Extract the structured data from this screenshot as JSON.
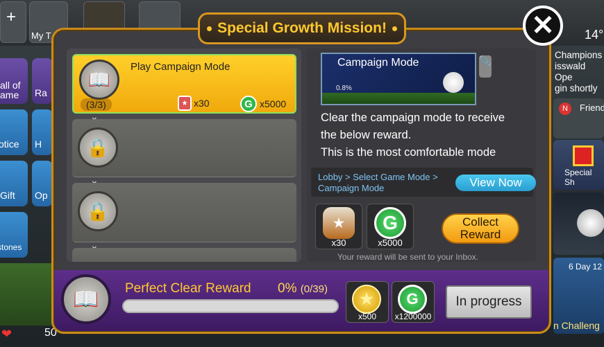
{
  "background": {
    "top_texts": [
      "My T",
      "14°"
    ],
    "left_menu": [
      "all of ame",
      "Ra",
      "otice",
      "H",
      "Gift",
      "Op",
      "stones"
    ],
    "right_menu": {
      "news_lines": [
        "Champions",
        "isswald Ope",
        "gin shortly"
      ],
      "friend_label": "Friend",
      "special_label": "Special Sh",
      "day_label": "6 Day 12",
      "challenge_label": "n Challeng"
    },
    "bottom_left_value": "50"
  },
  "modal": {
    "title": "Special Growth Mission!",
    "close_icon": "close-x-icon",
    "missions": [
      {
        "name": "Play Campaign Mode",
        "progress": "(3/3)",
        "reward_ticket": "x30",
        "reward_g": "x5000",
        "state": "active"
      },
      {
        "state": "locked"
      },
      {
        "state": "locked"
      },
      {
        "state": "locked"
      }
    ],
    "detail": {
      "banner_title": "Campaign Mode",
      "banner_percent": "0.8%",
      "description_lines": [
        "Clear the campaign mode to receive",
        "the below reward.",
        "This is the most comfortable mode"
      ],
      "path_line1": "Lobby > Select Game Mode >",
      "path_line2": "Campaign Mode",
      "view_now": "View Now",
      "rewards": [
        {
          "icon": "ticket-item-icon",
          "qty": "x30"
        },
        {
          "icon": "g-coin-icon",
          "qty": "x5000"
        }
      ],
      "collect_line1": "Collect",
      "collect_line2": "Reward",
      "note": "Your reward will be sent to your Inbox."
    },
    "footer": {
      "title": "Perfect Clear Reward",
      "percent": "0%",
      "count": "(0/39)",
      "progress_fraction": 0,
      "rewards": [
        {
          "icon": "gold-star-icon",
          "qty": "x500"
        },
        {
          "icon": "g-coin-icon",
          "qty": "x1200000"
        }
      ],
      "status": "In progress"
    }
  },
  "colors": {
    "accent": "#ffc82e",
    "frame": "#c98b1c",
    "active_mission": "#f0a90c",
    "g_coin": "#2fb84a",
    "footer": "#4a2170"
  }
}
